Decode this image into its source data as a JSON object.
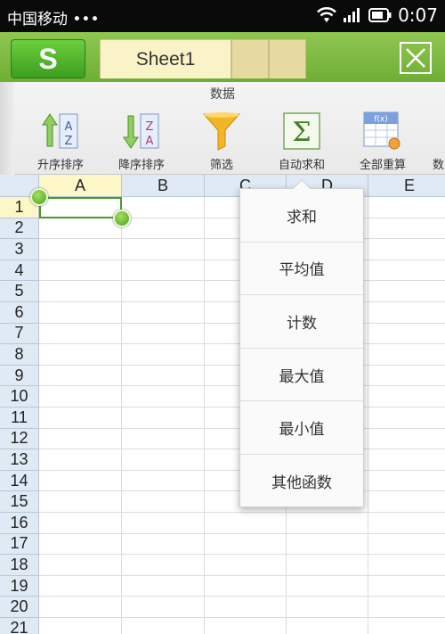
{
  "status": {
    "carrier": "中国移动 •••",
    "time": "0:07"
  },
  "tabs": {
    "logo": "S",
    "sheet_name": "Sheet1"
  },
  "toolbar": {
    "group_title": "数据",
    "tools": [
      {
        "label": "升序排序",
        "icon": "sort-ascending-icon"
      },
      {
        "label": "降序排序",
        "icon": "sort-descending-icon"
      },
      {
        "label": "筛选",
        "icon": "filter-icon"
      },
      {
        "label": "自动求和",
        "icon": "sigma-icon"
      },
      {
        "label": "全部重算",
        "icon": "recalculate-icon"
      },
      {
        "label": "数",
        "icon": ""
      }
    ]
  },
  "grid": {
    "columns": [
      "A",
      "B",
      "C",
      "D",
      "E"
    ],
    "rows": [
      "1",
      "2",
      "3",
      "4",
      "5",
      "6",
      "7",
      "8",
      "9",
      "10",
      "11",
      "12",
      "13",
      "14",
      "15",
      "16",
      "17",
      "18",
      "19",
      "20",
      "21"
    ],
    "selected_cell": "A1"
  },
  "autosum_menu": {
    "items": [
      "求和",
      "平均值",
      "计数",
      "最大值",
      "最小值",
      "其他函数"
    ]
  },
  "colors": {
    "accent_green": "#6fae36",
    "header_blue": "#dfeaf5",
    "active_header": "#fdf6c6"
  }
}
